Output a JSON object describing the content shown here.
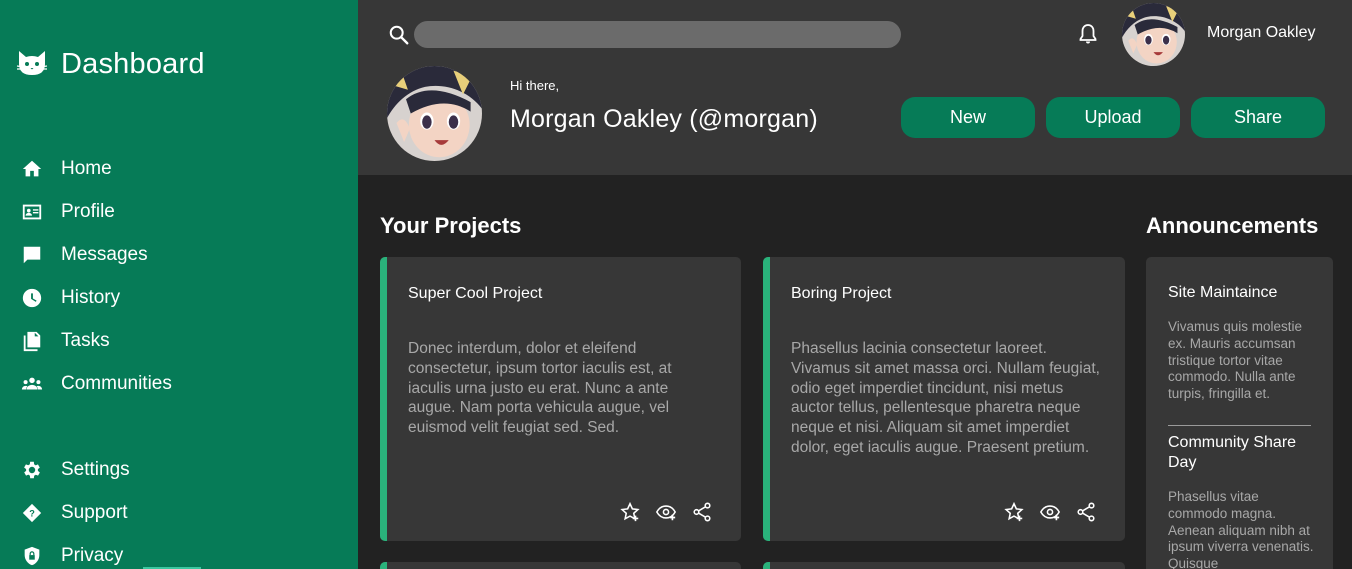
{
  "sidebar": {
    "brand_title": "Dashboard",
    "brand_icon": "cat-icon",
    "nav": [
      {
        "label": "Home",
        "icon": "home-icon"
      },
      {
        "label": "Profile",
        "icon": "profile-card-icon"
      },
      {
        "label": "Messages",
        "icon": "message-icon"
      },
      {
        "label": "History",
        "icon": "clock-icon"
      },
      {
        "label": "Tasks",
        "icon": "tasks-icon"
      },
      {
        "label": "Communities",
        "icon": "people-icon"
      }
    ],
    "footer_nav": [
      {
        "label": "Settings",
        "icon": "gear-icon"
      },
      {
        "label": "Support",
        "icon": "help-icon"
      },
      {
        "label": "Privacy",
        "icon": "shield-lock-icon"
      }
    ]
  },
  "header": {
    "search": {
      "placeholder": ""
    },
    "username": "Morgan Oakley",
    "greeting": "Hi there,",
    "full_name": "Morgan Oakley (@morgan)",
    "buttons": {
      "new": "New",
      "upload": "Upload",
      "share": "Share"
    }
  },
  "projects": {
    "title": "Your Projects",
    "items": [
      {
        "title": "Super Cool Project",
        "body": "Donec interdum, dolor et eleifend consectetur, ipsum tortor iaculis est, at iaculis urna justo eu erat. Nunc a ante augue. Nam porta vehicula augue, vel euismod velit feugiat sed. Sed."
      },
      {
        "title": "Boring Project",
        "body": "Phasellus lacinia consectetur laoreet. Vivamus sit amet massa orci. Nullam feugiat, odio eget imperdiet tincidunt, nisi metus auctor tellus, pellentesque pharetra neque neque et nisi. Aliquam sit amet imperdiet dolor, eget iaculis augue. Praesent pretium."
      }
    ]
  },
  "announcements": {
    "title": "Announcements",
    "items": [
      {
        "title": "Site Maintaince",
        "body": "Vivamus quis molestie ex. Mauris accumsan tristique tortor vitae commodo. Nulla ante turpis, fringilla et."
      },
      {
        "title": "Community Share Day",
        "body": "Phasellus vitae commodo magna. Aenean aliquam nibh at ipsum viverra venenatis. Quisque"
      }
    ]
  },
  "colors": {
    "brand_green": "#067b57",
    "accent_green": "#2ab27b",
    "panel": "#373737",
    "background": "#222222"
  }
}
